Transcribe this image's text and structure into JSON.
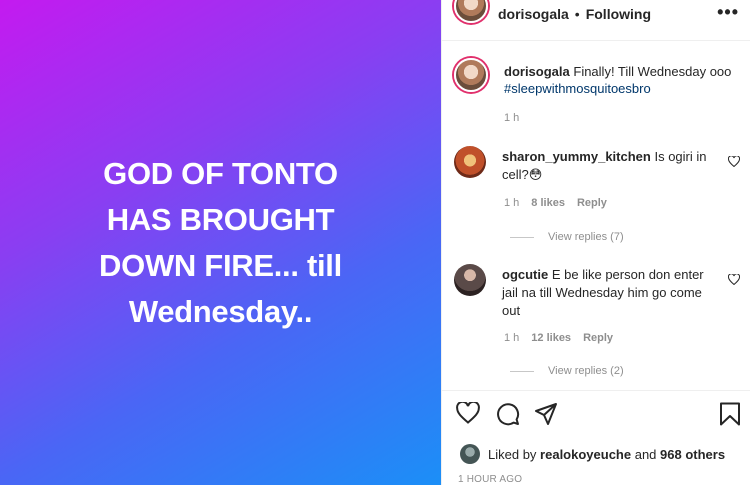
{
  "media": {
    "text": "GOD OF TONTO\nHAS BROUGHT\nDOWN FIRE... till\nWednesday.."
  },
  "header": {
    "username": "dorisogala",
    "separator": "•",
    "follow_status": "Following",
    "more_label": "•••"
  },
  "caption": {
    "username": "dorisogala",
    "text": "Finally! Till Wednesday ooo",
    "hashtag": "#sleepwithmosquitoesbro",
    "time": "1 h"
  },
  "comments": [
    {
      "username": "sharon_yummy_kitchen",
      "text": "Is ogiri in cell?😳",
      "time": "1 h",
      "likes": "8 likes",
      "reply": "Reply",
      "view_replies": "View replies (7)"
    },
    {
      "username": "ogcutie",
      "text": "E be like person don enter jail na till Wednesday him go come out",
      "time": "1 h",
      "likes": "12 likes",
      "reply": "Reply",
      "view_replies": "View replies (2)"
    }
  ],
  "liked_by": {
    "prefix": "Liked by",
    "user": "realokoyeuche",
    "conjunction": "and",
    "others": "968 others"
  },
  "post_time": "1 HOUR AGO",
  "icons": {
    "like": "heart-icon",
    "comment": "comment-icon",
    "share": "share-icon",
    "save": "bookmark-icon"
  }
}
